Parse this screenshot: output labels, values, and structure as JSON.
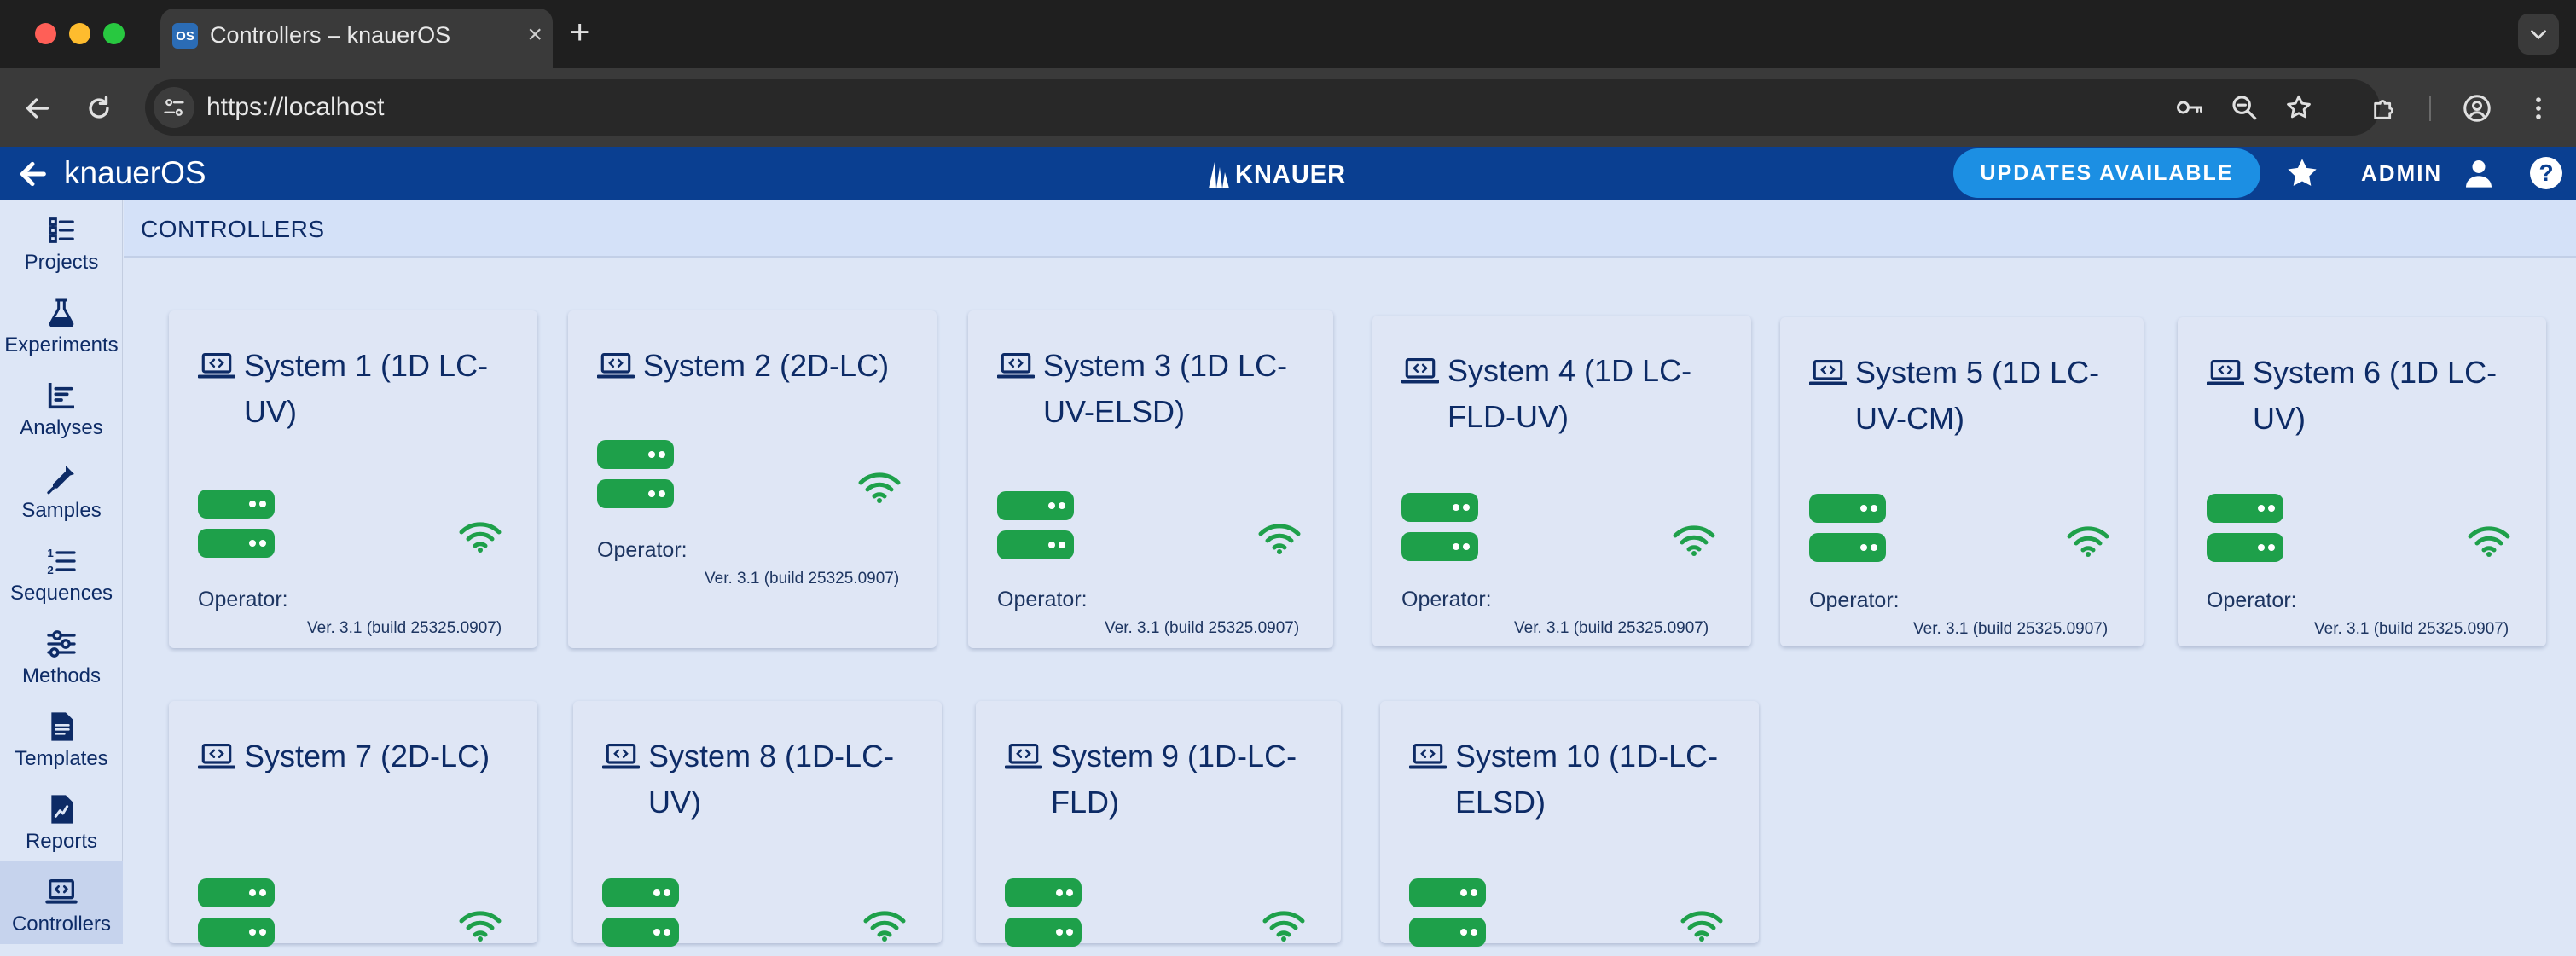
{
  "browser": {
    "tab_title": "Controllers – knauerOS",
    "tab_favicon": "OS",
    "new_tab": "+",
    "tab_close": "×",
    "url": "https://localhost"
  },
  "appbar": {
    "title": "knauerOS",
    "brand": "KNAUER",
    "updates_label": "UPDATES AVAILABLE",
    "admin_label": "ADMIN",
    "help_label": "?",
    "color_primary": "#0a3f91",
    "color_accent": "#1c8fe3"
  },
  "sidebar": {
    "items": [
      {
        "label": "Projects",
        "icon": "projects-icon"
      },
      {
        "label": "Experiments",
        "icon": "flask-icon"
      },
      {
        "label": "Analyses",
        "icon": "chart-icon"
      },
      {
        "label": "Samples",
        "icon": "pipette-icon"
      },
      {
        "label": "Sequences",
        "icon": "numbered-list-icon"
      },
      {
        "label": "Methods",
        "icon": "sliders-icon"
      },
      {
        "label": "Templates",
        "icon": "document-icon"
      },
      {
        "label": "Reports",
        "icon": "report-icon"
      },
      {
        "label": "Controllers",
        "icon": "controller-icon",
        "active": true
      }
    ]
  },
  "main": {
    "page_title": "CONTROLLERS",
    "status_color": "#1ea04a",
    "controllers": [
      {
        "name": "System 1 (1D LC-UV)",
        "line1": "System 1 (1D LC-",
        "line2": "UV)",
        "operator": "Operator:",
        "version": "Ver. 3.1 (build 25325.0907)"
      },
      {
        "name": "System 2 (2D-LC)",
        "line1": "System 2 (2D-LC)",
        "line2": "",
        "operator": "Operator:",
        "version": "Ver. 3.1 (build 25325.0907)"
      },
      {
        "name": "System 3 (1D LC-UV-ELSD)",
        "line1": "System 3 (1D LC-",
        "line2": "UV-ELSD)",
        "operator": "Operator:",
        "version": "Ver. 3.1 (build 25325.0907)"
      },
      {
        "name": "System 4 (1D LC-FLD-UV)",
        "line1": "System 4 (1D LC-",
        "line2": "FLD-UV)",
        "operator": "Operator:",
        "version": "Ver. 3.1 (build 25325.0907)"
      },
      {
        "name": "System 5 (1D LC-UV-CM)",
        "line1": "System 5 (1D LC-",
        "line2": "UV-CM)",
        "operator": "Operator:",
        "version": "Ver. 3.1 (build 25325.0907)"
      },
      {
        "name": "System 6 (1D LC-UV)",
        "line1": "System 6 (1D LC-",
        "line2": "UV)",
        "operator": "Operator:",
        "version": "Ver. 3.1 (build 25325.0907)"
      },
      {
        "name": "System 7 (2D-LC)",
        "line1": "System 7 (2D-LC)",
        "line2": ""
      },
      {
        "name": "System 8 (1D-LC-UV)",
        "line1": "System 8 (1D-LC-",
        "line2": "UV)"
      },
      {
        "name": "System 9 (1D-LC-FLD)",
        "line1": "System 9 (1D-LC-",
        "line2": "FLD)"
      },
      {
        "name": "System 10 (1D-LC-ELSD)",
        "line1": "System 10 (1D-LC-",
        "line2": "ELSD)"
      }
    ]
  }
}
